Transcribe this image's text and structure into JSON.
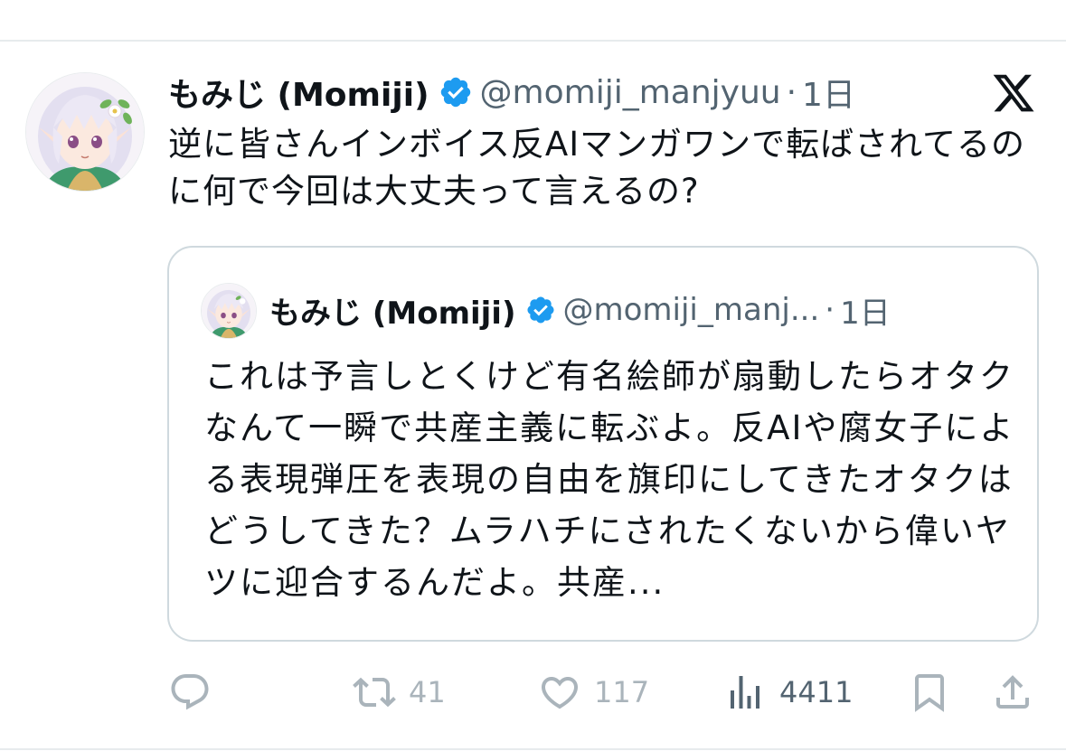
{
  "tweet": {
    "display_name": "もみじ (Momiji)",
    "handle": "@momiji_manjyuu",
    "separator": "·",
    "time": "1日",
    "text": "逆に皆さんインボイス反AIマンガワンで転ばされてるのに何で今回は大丈夫って言えるの?"
  },
  "quoted": {
    "display_name": "もみじ (Momiji)",
    "handle": "@momiji_manj...",
    "separator": "·",
    "time": "1日",
    "text": "これは予言しとくけど有名絵師が扇動したらオタクなんて一瞬で共産主義に転ぶよ。反AIや腐女子による表現弾圧を表現の自由を旗印にしてきたオタクはどうしてきた？ムラハチにされたくないから偉いヤツに迎合するんだよ。共産..."
  },
  "actions": {
    "reply_count": "",
    "retweet_count": "41",
    "like_count": "117",
    "view_count": "4411"
  },
  "colors": {
    "verified": "#1d9bf0",
    "secondary_text": "#536471",
    "muted_icon": "#aab4bb",
    "border": "#cfd9de"
  }
}
